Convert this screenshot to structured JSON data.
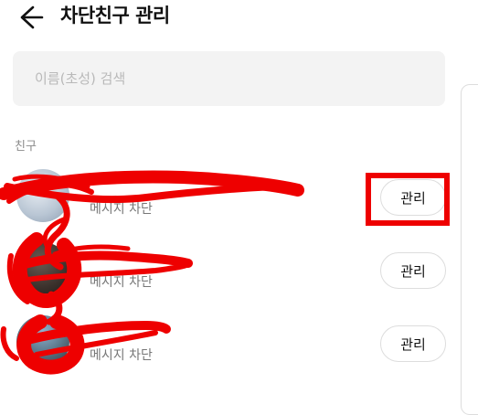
{
  "header": {
    "title": "차단친구 관리",
    "back_icon": "arrow-left-icon"
  },
  "search": {
    "placeholder": "이름(초성) 검색",
    "value": ""
  },
  "section": {
    "label": "친구"
  },
  "friends": [
    {
      "status": "메시지 차단",
      "button_label": "관리"
    },
    {
      "status": "메시지 차단",
      "button_label": "관리"
    },
    {
      "status": "메시지 차단",
      "button_label": "관리"
    }
  ],
  "annotation": {
    "color": "#ee0000"
  }
}
